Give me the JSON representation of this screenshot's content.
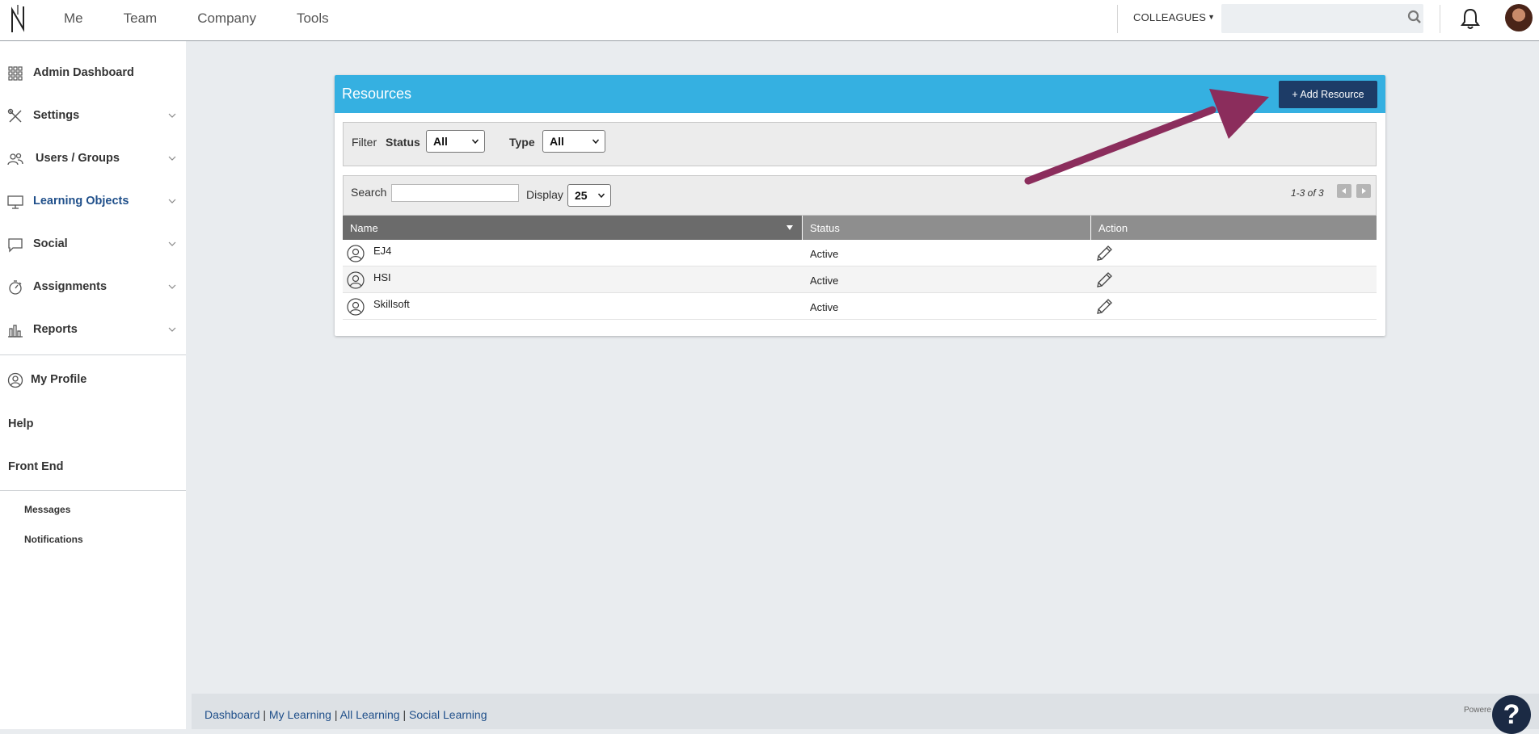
{
  "topnav": {
    "items": [
      "Me",
      "Team",
      "Company",
      "Tools"
    ]
  },
  "header": {
    "colleagues_label": "COLLEAGUES",
    "search_placeholder": ""
  },
  "sidebar": {
    "items": [
      {
        "label": "Admin Dashboard",
        "icon": "grid-icon"
      },
      {
        "label": "Settings",
        "icon": "tools-icon"
      },
      {
        "label": "Users / Groups",
        "icon": "users-icon"
      },
      {
        "label": "Learning Objects",
        "icon": "monitor-icon"
      },
      {
        "label": "Social",
        "icon": "chat-icon"
      },
      {
        "label": "Assignments",
        "icon": "stopwatch-icon"
      },
      {
        "label": "Reports",
        "icon": "bar-chart-icon"
      }
    ],
    "my_profile": "My Profile",
    "help": "Help",
    "front_end": "Front End",
    "messages": "Messages",
    "notifications": "Notifications"
  },
  "panel": {
    "title": "Resources",
    "add_button": "+ Add Resource",
    "filter": {
      "label": "Filter",
      "status_label": "Status",
      "status_value": "All",
      "type_label": "Type",
      "type_value": "All"
    },
    "toolbar": {
      "search_label": "Search",
      "search_value": "",
      "display_label": "Display",
      "display_value": "25",
      "pager_text": "1-3 of 3"
    },
    "columns": [
      "Name",
      "Status",
      "Action"
    ],
    "rows": [
      {
        "name": "EJ4",
        "status": "Active"
      },
      {
        "name": "HSI",
        "status": "Active"
      },
      {
        "name": "Skillsoft",
        "status": "Active"
      }
    ]
  },
  "footer": {
    "links": [
      "Dashboard",
      "My Learning",
      "All Learning",
      "Social Learning"
    ],
    "powered": "Powere",
    "help_icon": "?"
  },
  "colors": {
    "header_blue": "#35b0e1",
    "button_navy": "#1d3c67",
    "arrow": "#8b2d5c",
    "table_header_dark": "#6b6b6b",
    "table_header_mid": "#8e8e8e"
  }
}
